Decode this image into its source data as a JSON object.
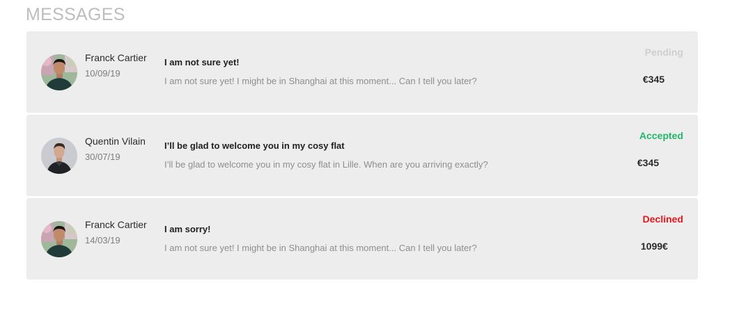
{
  "page": {
    "title": "MESSAGES"
  },
  "colors": {
    "card_background": "#ededed",
    "status_pending": "#cfcfcf",
    "status_accepted": "#21b66a",
    "status_declined": "#e8141e",
    "title_gray": "#bdbdbd"
  },
  "messages": [
    {
      "sender": "Franck Cartier",
      "date": "10/09/19",
      "subject": "I am not sure yet!",
      "preview": "I am not sure yet! I might be in Shanghai at this moment... Can I tell you later?",
      "status": "Pending",
      "status_color": "#cfcfcf",
      "price": "€345",
      "avatar": "franck-avatar"
    },
    {
      "sender": "Quentin Vilain",
      "date": "30/07/19",
      "subject": "I’ll be glad to welcome you in my cosy flat",
      "preview": "I’ll be glad to welcome you in my cosy flat in Lille. When are you arriving exactly?",
      "status": "Accepted",
      "status_color": "#21b66a",
      "price": "€345",
      "avatar": "quentin-avatar"
    },
    {
      "sender": "Franck Cartier",
      "date": "14/03/19",
      "subject": "I am sorry!",
      "preview": "I am not sure yet! I might be in Shanghai at this moment... Can I tell you later?",
      "status": "Declined",
      "status_color": "#e8141e",
      "price": "1099€",
      "avatar": "franck-avatar"
    }
  ]
}
